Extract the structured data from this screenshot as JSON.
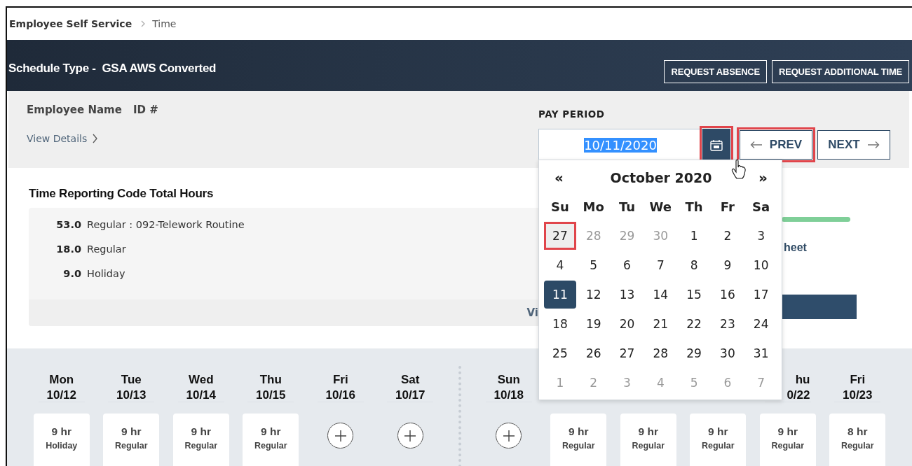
{
  "breadcrumb": {
    "items": [
      {
        "label": "Employee Self Service",
        "current": false
      },
      {
        "label": "Time",
        "current": true
      }
    ]
  },
  "schedule": {
    "title": "Schedule Type -  GSA AWS Converted",
    "actions": [
      "REQUEST ABSENCE",
      "REQUEST ADDITIONAL TIME"
    ]
  },
  "employee": {
    "name_label": "Employee Name",
    "id_label": "ID #",
    "details_link": "View Details"
  },
  "pay_period": {
    "label": "PAY PERIOD",
    "value": "10/11/2020",
    "value_selected": true,
    "calendar_button": {
      "highlighted": true
    },
    "prev": {
      "label": "PREV",
      "highlighted": true
    },
    "next": {
      "label": "NEXT",
      "highlighted": false
    }
  },
  "totals": {
    "title": "Time Reporting Code Total Hours",
    "rows": [
      {
        "hours": "53.0",
        "code": "Regular : 092-Telework Routine"
      },
      {
        "hours": "18.0",
        "code": "Regular"
      },
      {
        "hours": "9.0",
        "code": "Holiday"
      }
    ],
    "footer_link": "Vi"
  },
  "side_panel": {
    "link": "heet"
  },
  "date_picker": {
    "prev": "«",
    "title": "October 2020",
    "next": "»",
    "weekdays": [
      "Su",
      "Mo",
      "Tu",
      "We",
      "Th",
      "Fr",
      "Sa"
    ],
    "days": [
      {
        "label": "27",
        "muted": false,
        "selected": false,
        "hovered": true,
        "highlighted": true
      },
      {
        "label": "28",
        "muted": true,
        "selected": false,
        "hovered": false,
        "highlighted": false
      },
      {
        "label": "29",
        "muted": true,
        "selected": false,
        "hovered": false,
        "highlighted": false
      },
      {
        "label": "30",
        "muted": true,
        "selected": false,
        "hovered": false,
        "highlighted": false
      },
      {
        "label": "1",
        "muted": false,
        "selected": false,
        "hovered": false,
        "highlighted": false
      },
      {
        "label": "2",
        "muted": false,
        "selected": false,
        "hovered": false,
        "highlighted": false
      },
      {
        "label": "3",
        "muted": false,
        "selected": false,
        "hovered": false,
        "highlighted": false
      },
      {
        "label": "4",
        "muted": false,
        "selected": false,
        "hovered": false,
        "highlighted": false
      },
      {
        "label": "5",
        "muted": false,
        "selected": false,
        "hovered": false,
        "highlighted": false
      },
      {
        "label": "6",
        "muted": false,
        "selected": false,
        "hovered": false,
        "highlighted": false
      },
      {
        "label": "7",
        "muted": false,
        "selected": false,
        "hovered": false,
        "highlighted": false
      },
      {
        "label": "8",
        "muted": false,
        "selected": false,
        "hovered": false,
        "highlighted": false
      },
      {
        "label": "9",
        "muted": false,
        "selected": false,
        "hovered": false,
        "highlighted": false
      },
      {
        "label": "10",
        "muted": false,
        "selected": false,
        "hovered": false,
        "highlighted": false
      },
      {
        "label": "11",
        "muted": false,
        "selected": true,
        "hovered": false,
        "highlighted": false
      },
      {
        "label": "12",
        "muted": false,
        "selected": false,
        "hovered": false,
        "highlighted": false
      },
      {
        "label": "13",
        "muted": false,
        "selected": false,
        "hovered": false,
        "highlighted": false
      },
      {
        "label": "14",
        "muted": false,
        "selected": false,
        "hovered": false,
        "highlighted": false
      },
      {
        "label": "15",
        "muted": false,
        "selected": false,
        "hovered": false,
        "highlighted": false
      },
      {
        "label": "16",
        "muted": false,
        "selected": false,
        "hovered": false,
        "highlighted": false
      },
      {
        "label": "17",
        "muted": false,
        "selected": false,
        "hovered": false,
        "highlighted": false
      },
      {
        "label": "18",
        "muted": false,
        "selected": false,
        "hovered": false,
        "highlighted": false
      },
      {
        "label": "19",
        "muted": false,
        "selected": false,
        "hovered": false,
        "highlighted": false
      },
      {
        "label": "20",
        "muted": false,
        "selected": false,
        "hovered": false,
        "highlighted": false
      },
      {
        "label": "21",
        "muted": false,
        "selected": false,
        "hovered": false,
        "highlighted": false
      },
      {
        "label": "22",
        "muted": false,
        "selected": false,
        "hovered": false,
        "highlighted": false
      },
      {
        "label": "23",
        "muted": false,
        "selected": false,
        "hovered": false,
        "highlighted": false
      },
      {
        "label": "24",
        "muted": false,
        "selected": false,
        "hovered": false,
        "highlighted": false
      },
      {
        "label": "25",
        "muted": false,
        "selected": false,
        "hovered": false,
        "highlighted": false
      },
      {
        "label": "26",
        "muted": false,
        "selected": false,
        "hovered": false,
        "highlighted": false
      },
      {
        "label": "27",
        "muted": false,
        "selected": false,
        "hovered": false,
        "highlighted": false
      },
      {
        "label": "28",
        "muted": false,
        "selected": false,
        "hovered": false,
        "highlighted": false
      },
      {
        "label": "29",
        "muted": false,
        "selected": false,
        "hovered": false,
        "highlighted": false
      },
      {
        "label": "30",
        "muted": false,
        "selected": false,
        "hovered": false,
        "highlighted": false
      },
      {
        "label": "31",
        "muted": false,
        "selected": false,
        "hovered": false,
        "highlighted": false
      },
      {
        "label": "1",
        "muted": true,
        "selected": false,
        "hovered": false,
        "highlighted": false
      },
      {
        "label": "2",
        "muted": true,
        "selected": false,
        "hovered": false,
        "highlighted": false
      },
      {
        "label": "3",
        "muted": true,
        "selected": false,
        "hovered": false,
        "highlighted": false
      },
      {
        "label": "4",
        "muted": true,
        "selected": false,
        "hovered": false,
        "highlighted": false
      },
      {
        "label": "5",
        "muted": true,
        "selected": false,
        "hovered": false,
        "highlighted": false
      },
      {
        "label": "6",
        "muted": true,
        "selected": false,
        "hovered": false,
        "highlighted": false
      },
      {
        "label": "7",
        "muted": true,
        "selected": false,
        "hovered": false,
        "highlighted": false
      }
    ]
  },
  "weeks": [
    {
      "days": [
        {
          "day": "Mon",
          "date": "10/12",
          "kind": "entry",
          "hours": "9 hr",
          "code": "Holiday"
        },
        {
          "day": "Tue",
          "date": "10/13",
          "kind": "entry",
          "hours": "9 hr",
          "code": "Regular"
        },
        {
          "day": "Wed",
          "date": "10/14",
          "kind": "entry",
          "hours": "9 hr",
          "code": "Regular"
        },
        {
          "day": "Thu",
          "date": "10/15",
          "kind": "entry",
          "hours": "9 hr",
          "code": "Regular"
        },
        {
          "day": "Fri",
          "date": "10/16",
          "kind": "empty"
        },
        {
          "day": "Sat",
          "date": "10/17",
          "kind": "empty"
        }
      ]
    },
    {
      "days": [
        {
          "day": "Sun",
          "date": "10/18",
          "kind": "empty"
        },
        {
          "kind": "entry",
          "hours": "9 hr",
          "code": "Regular"
        },
        {
          "kind": "entry",
          "hours": "9 hr",
          "code": "Regular"
        },
        {
          "kind": "entry",
          "hours": "9 hr",
          "code": "Regular"
        },
        {
          "day": "hu",
          "date": "0/22",
          "partly_covered": true,
          "kind": "entry",
          "hours": "9 hr",
          "code": "Regular"
        },
        {
          "day": "Fri",
          "date": "10/23",
          "kind": "entry",
          "hours": "8 hr",
          "code": "Regular"
        }
      ]
    }
  ]
}
